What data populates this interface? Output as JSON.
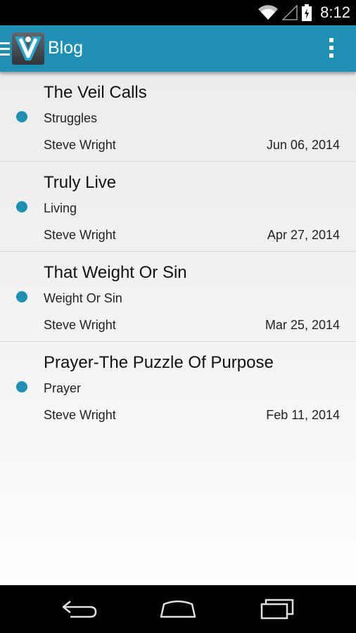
{
  "status_bar": {
    "time": "8:12"
  },
  "action_bar": {
    "title": "Blog"
  },
  "posts": [
    {
      "title": "The Veil Calls",
      "category": "Struggles",
      "author": "Steve Wright",
      "date": "Jun 06, 2014"
    },
    {
      "title": "Truly Live",
      "category": "Living",
      "author": "Steve Wright",
      "date": "Apr 27, 2014"
    },
    {
      "title": "That Weight Or Sin",
      "category": "Weight Or Sin",
      "author": "Steve Wright",
      "date": "Mar 25, 2014"
    },
    {
      "title": "Prayer-The Puzzle Of Purpose",
      "category": "Prayer",
      "author": "Steve Wright",
      "date": "Feb 11, 2014"
    }
  ],
  "colors": {
    "accent": "#1f8fb3"
  },
  "icons": [
    "wifi-icon",
    "signal-icon",
    "battery-icon",
    "drawer-icon",
    "overflow-menu-icon",
    "back-icon",
    "home-icon",
    "recents-icon"
  ]
}
